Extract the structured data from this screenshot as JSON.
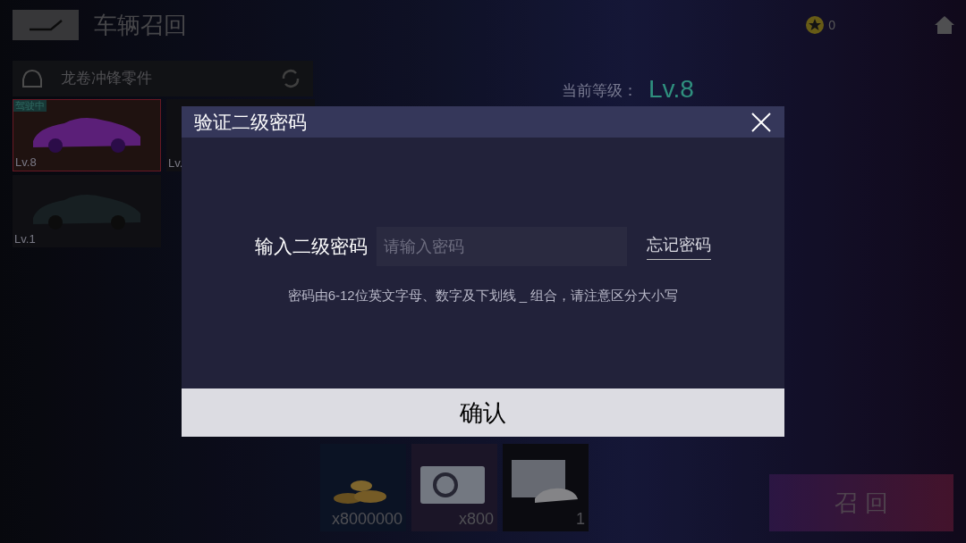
{
  "header": {
    "title": "车辆召回",
    "currency": "0"
  },
  "part": {
    "name": "龙卷冲锋零件"
  },
  "cars": [
    {
      "level": "Lv.8",
      "selected": true,
      "badge": "驾驶中"
    },
    {
      "level": "Lv.",
      "selected": false
    },
    {
      "level": "Lv.1",
      "selected": false
    }
  ],
  "current_level": {
    "label": "当前等级：",
    "value": "Lv.8"
  },
  "rewards": [
    {
      "kind": "coins",
      "count": "x8000000"
    },
    {
      "kind": "card",
      "count": "x800"
    },
    {
      "kind": "blueprint",
      "count": "1"
    }
  ],
  "recall_button": "召 回",
  "dialog": {
    "title": "验证二级密码",
    "field_label": "输入二级密码",
    "placeholder": "请输入密码",
    "forgot": "忘记密码",
    "hint": "密码由6-12位英文字母、数字及下划线 _ 组合，请注意区分大小写",
    "confirm": "确认"
  }
}
